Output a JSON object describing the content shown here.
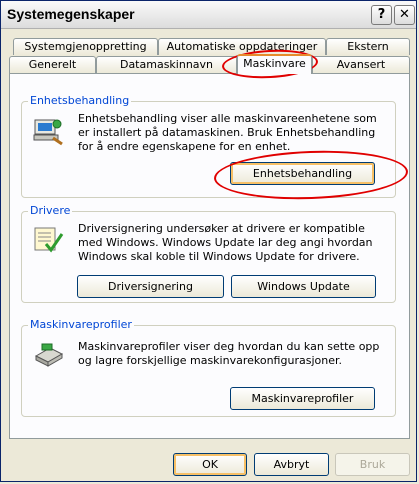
{
  "window": {
    "title": "Systemegenskaper",
    "help_label": "?",
    "close_label": "✕"
  },
  "tabs_row1": [
    {
      "label": "Systemgjenoppretting"
    },
    {
      "label": "Automatiske oppdateringer"
    },
    {
      "label": "Ekstern"
    }
  ],
  "tabs_row2": [
    {
      "label": "Generelt"
    },
    {
      "label": "Datamaskinnavn"
    },
    {
      "label": "Maskinvare"
    },
    {
      "label": "Avansert"
    }
  ],
  "groups": {
    "device_manager": {
      "title": "Enhetsbehandling",
      "text": "Enhetsbehandling viser alle maskinvareenhetene som er installert på datamaskinen. Bruk Enhetsbehandling for å endre egenskapene for en enhet.",
      "button": "Enhetsbehandling",
      "icon": "device-manager-icon"
    },
    "drivers": {
      "title": "Drivere",
      "text": "Driversignering undersøker at drivere er kompatible med Windows. Windows Update lar deg angi hvordan Windows skal koble til Windows Update for drivere.",
      "button_signing": "Driversignering",
      "button_update": "Windows Update",
      "icon": "driver-checklist-icon"
    },
    "profiles": {
      "title": "Maskinvareprofiler",
      "text": "Maskinvareprofiler viser deg hvordan du kan sette opp og lagre forskjellige maskinvarekonfigurasjoner.",
      "button": "Maskinvareprofiler",
      "icon": "hardware-profile-icon"
    }
  },
  "footer": {
    "ok": "OK",
    "cancel": "Avbryt",
    "apply": "Bruk"
  }
}
